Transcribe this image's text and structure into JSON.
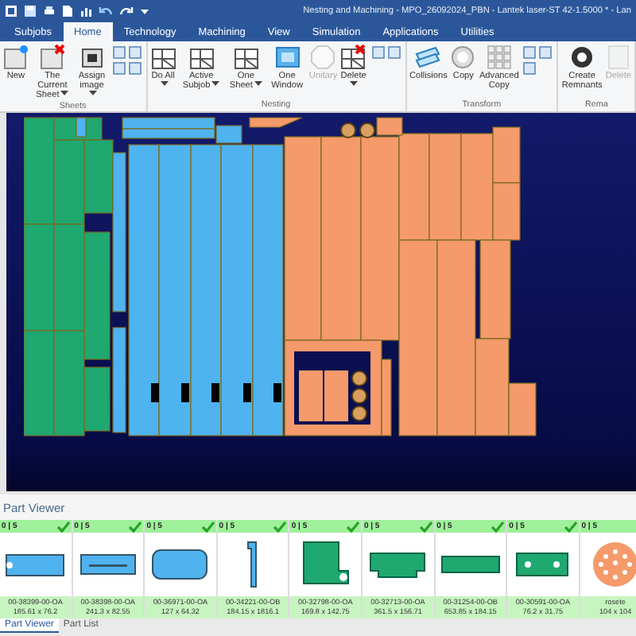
{
  "window": {
    "title": "Nesting and Machining - MPO_26092024_PBN - Lantek laser-ST 42-1.5000 * - Lan"
  },
  "tabs": [
    {
      "label": "Subjobs",
      "selected": false
    },
    {
      "label": "Home",
      "selected": true
    },
    {
      "label": "Technology",
      "selected": false
    },
    {
      "label": "Machining",
      "selected": false
    },
    {
      "label": "View",
      "selected": false
    },
    {
      "label": "Simulation",
      "selected": false
    },
    {
      "label": "Applications",
      "selected": false
    },
    {
      "label": "Utilities",
      "selected": false
    }
  ],
  "ribbon": [
    {
      "label": "Sheets",
      "buttons": [
        {
          "label": "New",
          "kind": "new",
          "menu": false,
          "disabled": false
        },
        {
          "label": "The Current Sheet",
          "kind": "sheet-x",
          "menu": true,
          "disabled": false
        },
        {
          "label": "Assign image",
          "kind": "camera",
          "menu": true,
          "disabled": false
        }
      ]
    },
    {
      "label": "Nesting",
      "buttons": [
        {
          "label": "Do All",
          "kind": "nest",
          "menu": true,
          "disabled": false
        },
        {
          "label": "Active Subjob",
          "kind": "nest",
          "menu": true,
          "disabled": false
        },
        {
          "label": "One Sheet",
          "kind": "nest",
          "menu": true,
          "disabled": false
        },
        {
          "label": "One Window",
          "kind": "window",
          "menu": false,
          "disabled": false
        },
        {
          "label": "Unitary",
          "kind": "octagon",
          "menu": false,
          "disabled": true
        },
        {
          "label": "Delete",
          "kind": "nest-x",
          "menu": true,
          "disabled": false
        }
      ]
    },
    {
      "label": "Transform",
      "buttons": [
        {
          "label": "Collisions",
          "kind": "collision",
          "menu": false,
          "disabled": false
        },
        {
          "label": "Copy",
          "kind": "circle",
          "menu": false,
          "disabled": false
        },
        {
          "label": "Advanced Copy",
          "kind": "grid",
          "menu": false,
          "disabled": false
        }
      ]
    },
    {
      "label": "Rema",
      "buttons": [
        {
          "label": "Create Remnants",
          "kind": "gear",
          "menu": false,
          "disabled": false
        },
        {
          "label": "Delete",
          "kind": "doc",
          "menu": false,
          "disabled": true
        }
      ]
    }
  ],
  "part_viewer": {
    "title": "Part Viewer",
    "parts": [
      {
        "count": "0 | 5",
        "checked": true,
        "name": "00-38399-00-OA",
        "size": "185.61 x 76.2",
        "kind": "plate-hole",
        "color": "#4fb3f0"
      },
      {
        "count": "0 | 5",
        "checked": true,
        "name": "00-38398-00-OA",
        "size": "241.3 x 82.55",
        "kind": "slot",
        "color": "#4fb3f0"
      },
      {
        "count": "0 | 5",
        "checked": true,
        "name": "00-36971-00-OA",
        "size": "127 x 64.32",
        "kind": "rounded",
        "color": "#4fb3f0"
      },
      {
        "count": "0 | 5",
        "checked": true,
        "name": "00-34221-00-OB",
        "size": "184.15 x 1816.1",
        "kind": "strip",
        "color": "#4fb3f0"
      },
      {
        "count": "0 | 5",
        "checked": true,
        "name": "00-32798-00-OA",
        "size": "169.8 x 142.75",
        "kind": "bracket",
        "color": "#1fa870"
      },
      {
        "count": "0 | 5",
        "checked": true,
        "name": "00-32713-00-OA",
        "size": "361.5 x 156.71",
        "kind": "tab",
        "color": "#1fa870"
      },
      {
        "count": "0 | 5",
        "checked": true,
        "name": "00-31254-00-OB",
        "size": "653.85 x 184.15",
        "kind": "bar",
        "color": "#1fa870"
      },
      {
        "count": "0 | 5",
        "checked": true,
        "name": "00-30591-00-OA",
        "size": "76.2 x 31.75",
        "kind": "two-holes",
        "color": "#1fa870"
      },
      {
        "count": "0 | 5",
        "name": "rosete",
        "size": "104 x 104",
        "kind": "rosette",
        "color": "#f59a6a"
      }
    ]
  },
  "bottom_tabs": [
    {
      "label": "Part Viewer",
      "selected": true
    },
    {
      "label": "Part List",
      "selected": false
    }
  ]
}
